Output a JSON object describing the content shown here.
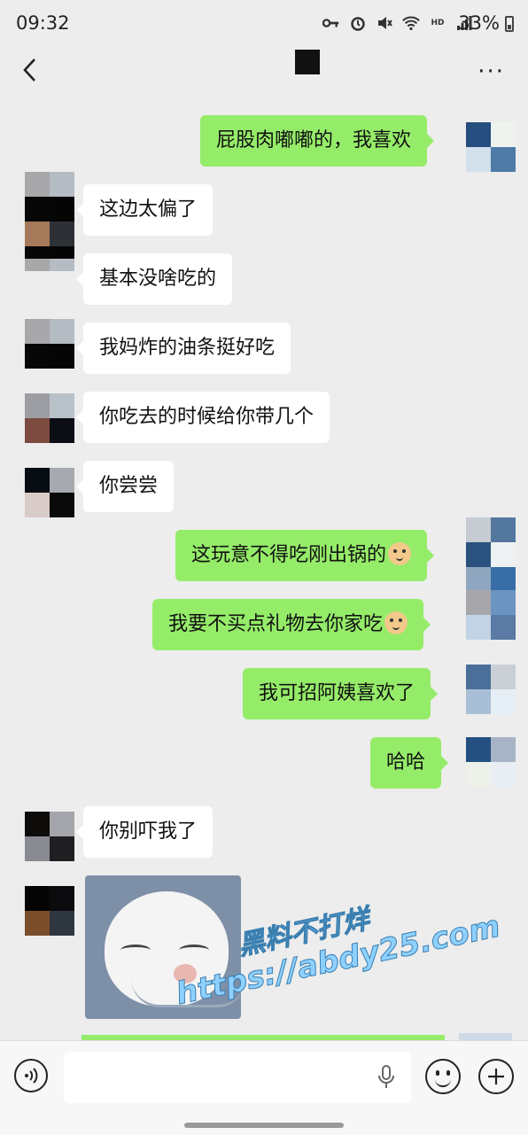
{
  "status_bar": {
    "time": "09:32",
    "battery": "33%",
    "icons": [
      "key-icon",
      "alarm-icon",
      "mute-icon",
      "wifi-icon",
      "hd-icon",
      "signal-icon"
    ]
  },
  "header": {
    "back_icon": "chevron-left-icon",
    "more_label": "···"
  },
  "messages": [
    {
      "direction": "out",
      "text": "屁股肉嘟嘟的，我喜欢"
    },
    {
      "direction": "in",
      "text": "这边太偏了"
    },
    {
      "direction": "in",
      "text": "基本没啥吃的"
    },
    {
      "direction": "in",
      "text": "我妈炸的油条挺好吃"
    },
    {
      "direction": "in",
      "text": "你吃去的时候给你带几个"
    },
    {
      "direction": "in",
      "text": "你尝尝"
    },
    {
      "direction": "out",
      "text": "这玩意不得吃刚出锅的",
      "emoji": "doge-icon"
    },
    {
      "direction": "out",
      "text": "我要不买点礼物去你家吃",
      "emoji": "doge-icon"
    },
    {
      "direction": "out",
      "text": "我可招阿姨喜欢了"
    },
    {
      "direction": "out",
      "text": "哈哈"
    },
    {
      "direction": "in",
      "text": "你别吓我了"
    },
    {
      "direction": "in",
      "type": "sticker",
      "sticker": "panda-face-sticker"
    }
  ],
  "watermark": {
    "line1": "黑料不打烊",
    "line2": "https://abdy25.com"
  },
  "input_bar": {
    "voice_icon": "voice-icon",
    "mic_icon": "mic-icon",
    "emoji_icon": "emoji-icon",
    "plus_icon": "plus-icon"
  },
  "colors": {
    "background": "#ededed",
    "outgoing_bubble": "#95ec69",
    "incoming_bubble": "#ffffff"
  }
}
